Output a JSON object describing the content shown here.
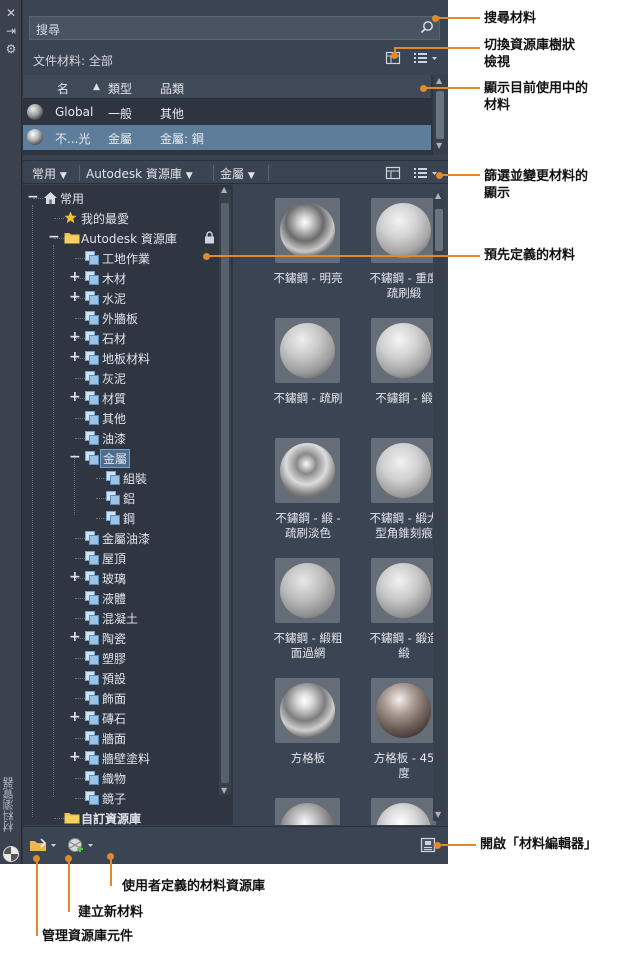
{
  "window": {
    "title": "材料瀏覽器"
  },
  "search": {
    "placeholder": "搜尋"
  },
  "doc_materials": {
    "label": "文件材料: 全部",
    "columns": {
      "name": "名",
      "type": "類型",
      "category": "品類"
    },
    "rows": [
      {
        "name": "Global",
        "type": "一般",
        "category": "其他"
      },
      {
        "name": "不...光",
        "type": "金屬",
        "category": "金屬: 鋼"
      }
    ]
  },
  "library_bar": {
    "home": "常用",
    "library": "Autodesk 資源庫",
    "category": "金屬"
  },
  "tree": {
    "root": "常用",
    "favorites": "我的最愛",
    "autodesk_lib": "Autodesk 資源庫",
    "items": [
      {
        "label": "工地作業",
        "expand": false
      },
      {
        "label": "木材",
        "expand": true
      },
      {
        "label": "水泥",
        "expand": true
      },
      {
        "label": "外牆板",
        "expand": false
      },
      {
        "label": "石材",
        "expand": true
      },
      {
        "label": "地板材料",
        "expand": true
      },
      {
        "label": "灰泥",
        "expand": false
      },
      {
        "label": "材質",
        "expand": true
      },
      {
        "label": "其他",
        "expand": false
      },
      {
        "label": "油漆",
        "expand": false
      }
    ],
    "metal": "金屬",
    "metal_children": [
      "組裝",
      "鋁",
      "鋼"
    ],
    "items_after": [
      {
        "label": "金屬油漆",
        "expand": false
      },
      {
        "label": "屋頂",
        "expand": false
      },
      {
        "label": "玻璃",
        "expand": true
      },
      {
        "label": "液體",
        "expand": false
      },
      {
        "label": "混凝土",
        "expand": false
      },
      {
        "label": "陶瓷",
        "expand": true
      },
      {
        "label": "塑膠",
        "expand": false
      },
      {
        "label": "預設",
        "expand": false
      },
      {
        "label": "飾面",
        "expand": false
      },
      {
        "label": "磚石",
        "expand": true
      },
      {
        "label": "牆面",
        "expand": false
      },
      {
        "label": "牆壁塗料",
        "expand": true
      },
      {
        "label": "織物",
        "expand": false
      },
      {
        "label": "鏡子",
        "expand": false
      }
    ],
    "custom_lib": "自訂資源庫"
  },
  "materials": [
    {
      "label1": "不鏽鋼 - 明亮",
      "label2": ""
    },
    {
      "label1": "不鏽鋼 - 重度",
      "label2": "疏刷緞"
    },
    {
      "label1": "不鏽鋼 - 疏刷",
      "label2": ""
    },
    {
      "label1": "不鏽鋼 - 緞",
      "label2": ""
    },
    {
      "label1": "不鏽鋼 - 緞 -",
      "label2": "疏刷淡色"
    },
    {
      "label1": "不鏽鋼 - 緞大",
      "label2": "型角錐刻痕"
    },
    {
      "label1": "不鏽鋼 - 緞粗",
      "label2": "面過網"
    },
    {
      "label1": "不鏽鋼 - 鍛造",
      "label2": "緞"
    },
    {
      "label1": "方格板",
      "label2": ""
    },
    {
      "label1": "方格板 - 45",
      "label2": "度"
    },
    {
      "label1": "",
      "label2": ""
    },
    {
      "label1": "",
      "label2": ""
    }
  ],
  "callouts": {
    "search": "搜尋材料",
    "toggle_tree_1": "切換資源庫樹狀",
    "toggle_tree_2": "檢視",
    "show_current_1": "顯示目前使用中的",
    "show_current_2": "材料",
    "filter_1": "篩選並變更材料的",
    "filter_2": "顯示",
    "predefined": "預先定義的材料",
    "open_editor": "開啟「材料編輯器」",
    "user_libs": "使用者定義的材料資源庫",
    "create_new": "建立新材料",
    "manage_libs": "管理資源庫元件"
  },
  "colors": {
    "callout": "#e08a2a",
    "panel": "#3b4452",
    "selection": "#5d7d9a"
  }
}
